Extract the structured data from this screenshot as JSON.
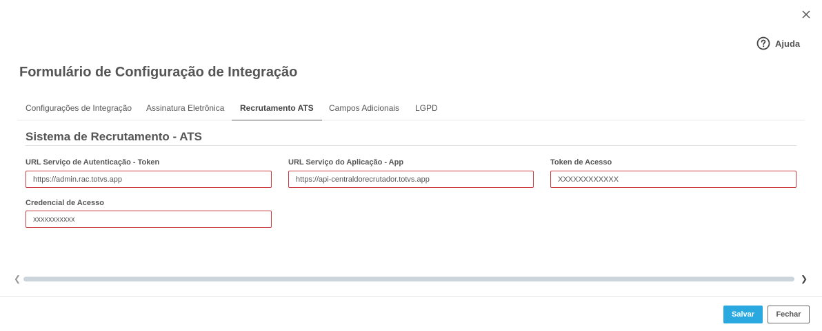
{
  "header": {
    "help_label": "Ajuda",
    "title": "Formulário de Configuração de Integração"
  },
  "tabs": [
    {
      "label": "Configurações de Integração",
      "active": false
    },
    {
      "label": "Assinatura Eletrônica",
      "active": false
    },
    {
      "label": "Recrutamento ATS",
      "active": true
    },
    {
      "label": "Campos Adicionais",
      "active": false
    },
    {
      "label": "LGPD",
      "active": false
    }
  ],
  "section": {
    "title": "Sistema de Recrutamento - ATS"
  },
  "fields": {
    "auth_url": {
      "label": "URL Serviço de Autenticação - Token",
      "value": "https://admin.rac.totvs.app"
    },
    "app_url": {
      "label": "URL Serviço do Aplicação - App",
      "value": "https://api-centraldorecrutador.totvs.app"
    },
    "token": {
      "label": "Token de Acesso",
      "value": "XXXXXXXXXXXX"
    },
    "credential": {
      "label": "Credencial de Acesso",
      "value": "xxxxxxxxxxx"
    }
  },
  "footer": {
    "save_label": "Salvar",
    "close_label": "Fechar"
  },
  "colors": {
    "primary": "#29a9df",
    "invalid_border": "#c9393d"
  },
  "icons": [
    "close-icon",
    "help-icon",
    "chevron-left-icon",
    "chevron-right-icon"
  ]
}
